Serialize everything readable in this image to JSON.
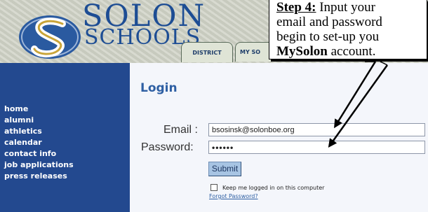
{
  "header": {
    "logo_line1": "SOLON",
    "logo_line2": "SCHOOLS",
    "tabs": [
      {
        "label": "DISTRICT"
      },
      {
        "label": "MY SO"
      }
    ]
  },
  "sidebar": {
    "items": [
      {
        "label": "home"
      },
      {
        "label": "alumni"
      },
      {
        "label": "athletics"
      },
      {
        "label": "calendar"
      },
      {
        "label": "contact info"
      },
      {
        "label": "job applications"
      },
      {
        "label": "press releases"
      }
    ]
  },
  "login": {
    "title": "Login",
    "email_label": "Email :",
    "email_value": "bsosinsk@solonboe.org",
    "password_label": "Password:",
    "password_value": "••••••",
    "submit_label": "Submit",
    "remember_label": "Keep me logged in on this computer",
    "forgot_label": "Forgot Password?"
  },
  "callout": {
    "step": "Step 4:",
    "line1": " Input your",
    "line2": "email and password",
    "line3": "begin to set-up you",
    "brand": "MySolon",
    "line4_rest": " account."
  },
  "colors": {
    "sidebar_blue": "#23498f",
    "logo_blue": "#1d4d94",
    "title_blue": "#2e5fa3",
    "button_blue": "#a7c4e3"
  }
}
